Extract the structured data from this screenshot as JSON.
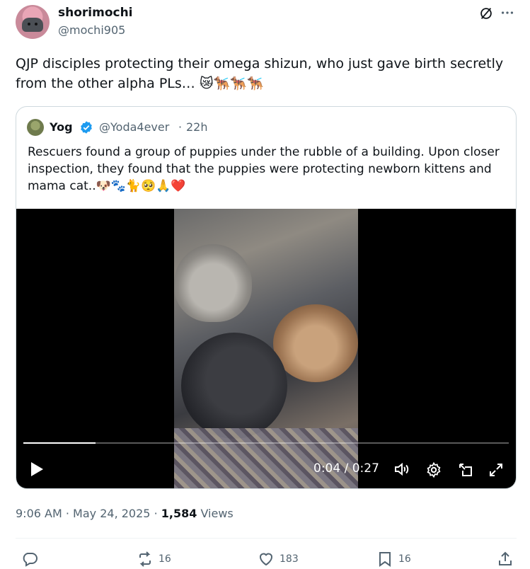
{
  "author": {
    "name": "shorimochi",
    "handle": "@mochi905"
  },
  "tweet": {
    "text": "QJP disciples protecting their omega shizun, who just gave birth secretly from the other alpha PLs… 😿🐕‍🦺🐕‍🦺🐕‍🦺"
  },
  "quote": {
    "name": "Yog",
    "handle": "@Yoda4ever",
    "separator": "·",
    "time": "22h",
    "text": "Rescuers found a group of puppies under the rubble of a building. Upon closer inspection, they found that the puppies were protecting newborn kittens and mama cat..🐶🐾🐈🥺🙏❤️"
  },
  "video": {
    "time_display": "0:04 / 0:27",
    "progress": 0.148
  },
  "meta": {
    "time": "9:06 AM",
    "date": "May 24, 2025",
    "sep": "·",
    "views_count": "1,584",
    "views_label": "Views"
  },
  "actions": {
    "reply": "",
    "repost": "16",
    "like": "183",
    "bookmark": "16"
  },
  "colors": {
    "text": "#0f1419",
    "muted": "#536471",
    "verified": "#1d9bf0",
    "border": "#cfd9de"
  },
  "icons": [
    "grok-icon",
    "more-icon",
    "verified-icon",
    "play-icon",
    "volume-icon",
    "settings-icon",
    "pip-icon",
    "fullscreen-icon",
    "reply-icon",
    "repost-icon",
    "like-icon",
    "bookmark-icon",
    "share-icon"
  ]
}
